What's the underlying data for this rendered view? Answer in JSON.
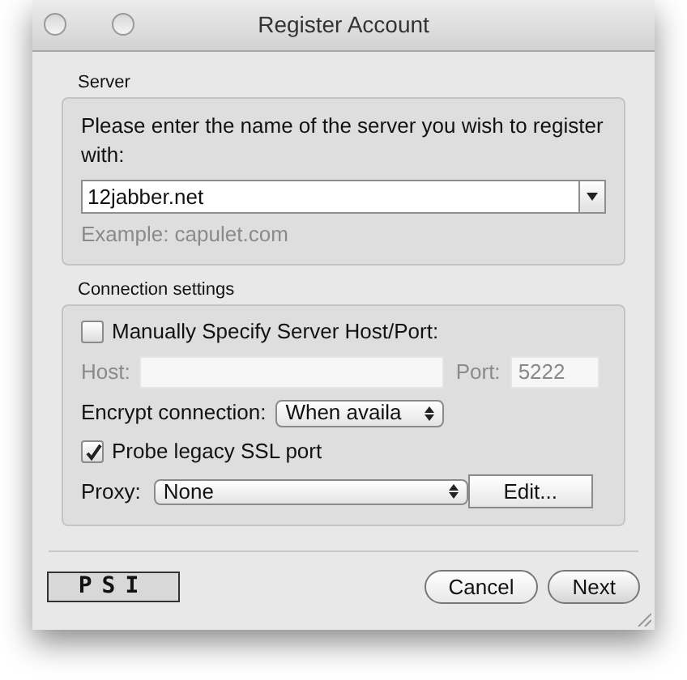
{
  "window": {
    "title": "Register Account"
  },
  "server": {
    "heading": "Server",
    "prompt": "Please enter the name of the server you wish to register with:",
    "value": "12jabber.net",
    "hint": "Example: capulet.com"
  },
  "connection": {
    "heading": "Connection settings",
    "manual": {
      "label": "Manually Specify Server Host/Port:",
      "checked": false
    },
    "host": {
      "label": "Host:",
      "disabled": true
    },
    "port": {
      "label": "Port:",
      "value": "5222",
      "disabled": true
    },
    "encrypt": {
      "label": "Encrypt connection:",
      "value": "When availa"
    },
    "probe": {
      "label": "Probe legacy SSL port",
      "checked": true
    },
    "proxy": {
      "label": "Proxy:",
      "value": "None",
      "edit": "Edit..."
    }
  },
  "footer": {
    "logo": "PSI",
    "buttons": [
      {
        "label": "Cancel",
        "kind": "cancel"
      },
      {
        "label": "Next",
        "kind": "default"
      }
    ]
  }
}
